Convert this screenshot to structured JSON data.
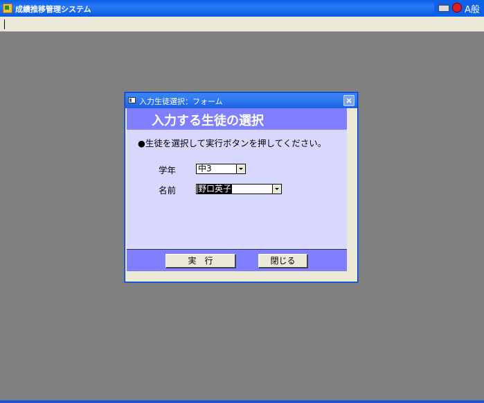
{
  "app": {
    "title": "成績推移管理システム",
    "ime_label": "A般"
  },
  "dialog": {
    "title": "入力生徒選択：フォーム",
    "header": "入力する生徒の選択",
    "instruction": "●生徒を選択して実行ボタンを押してください。",
    "grade": {
      "label": "学年",
      "value": "中3"
    },
    "name": {
      "label": "名前",
      "value": "野口英子"
    },
    "buttons": {
      "execute": "実　行",
      "close": "閉じる"
    }
  },
  "colors": {
    "desktop": "#808080",
    "header_band": "#8080ff",
    "content_bg": "#d8d8ff",
    "titlebar": "#2a7bf6"
  }
}
